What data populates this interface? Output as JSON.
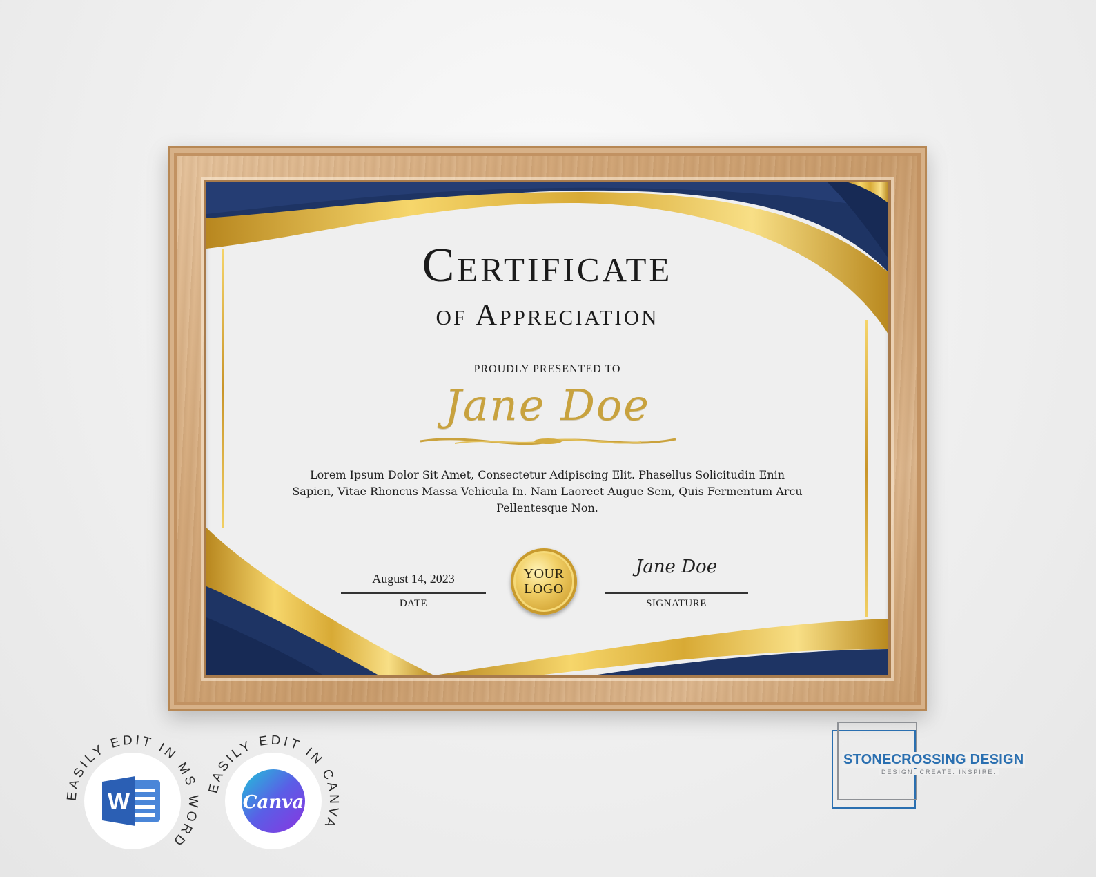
{
  "certificate": {
    "title": "Certificate",
    "subtitle": "of Appreciation",
    "presented_to": "PROUDLY PRESENTED TO",
    "recipient": "Jane Doe",
    "body": "Lorem Ipsum Dolor Sit Amet, Consectetur Adipiscing Elit. Phasellus Solicitudin Enin Sapien, Vitae Rhoncus Massa Vehicula In. Nam Laoreet Augue Sem, Quis Fermentum Arcu Pellentesque Non.",
    "date_value": "August 14, 2023",
    "date_label": "DATE",
    "signature_value": "Jane Doe",
    "signature_label": "SIGNATURE",
    "seal_line1": "YOUR",
    "seal_line2": "LOGO"
  },
  "badges": {
    "word_text": "EASILY EDIT IN MS WORD",
    "word_letter": "W",
    "canva_text": "EASILY EDIT IN CANVA",
    "canva_word": "Canva"
  },
  "brand": {
    "name": "STONECROSSING DESIGN",
    "tagline": "DESIGN. CREATE. INSPIRE."
  },
  "colors": {
    "navy": "#1e3464",
    "gold": "#d6a93a",
    "word_blue": "#2b5fb4",
    "canva_purple": "#7b3fe4",
    "brand_blue": "#2a6fb0"
  },
  "icons": [
    "word-icon",
    "canva-icon",
    "seal-icon"
  ]
}
